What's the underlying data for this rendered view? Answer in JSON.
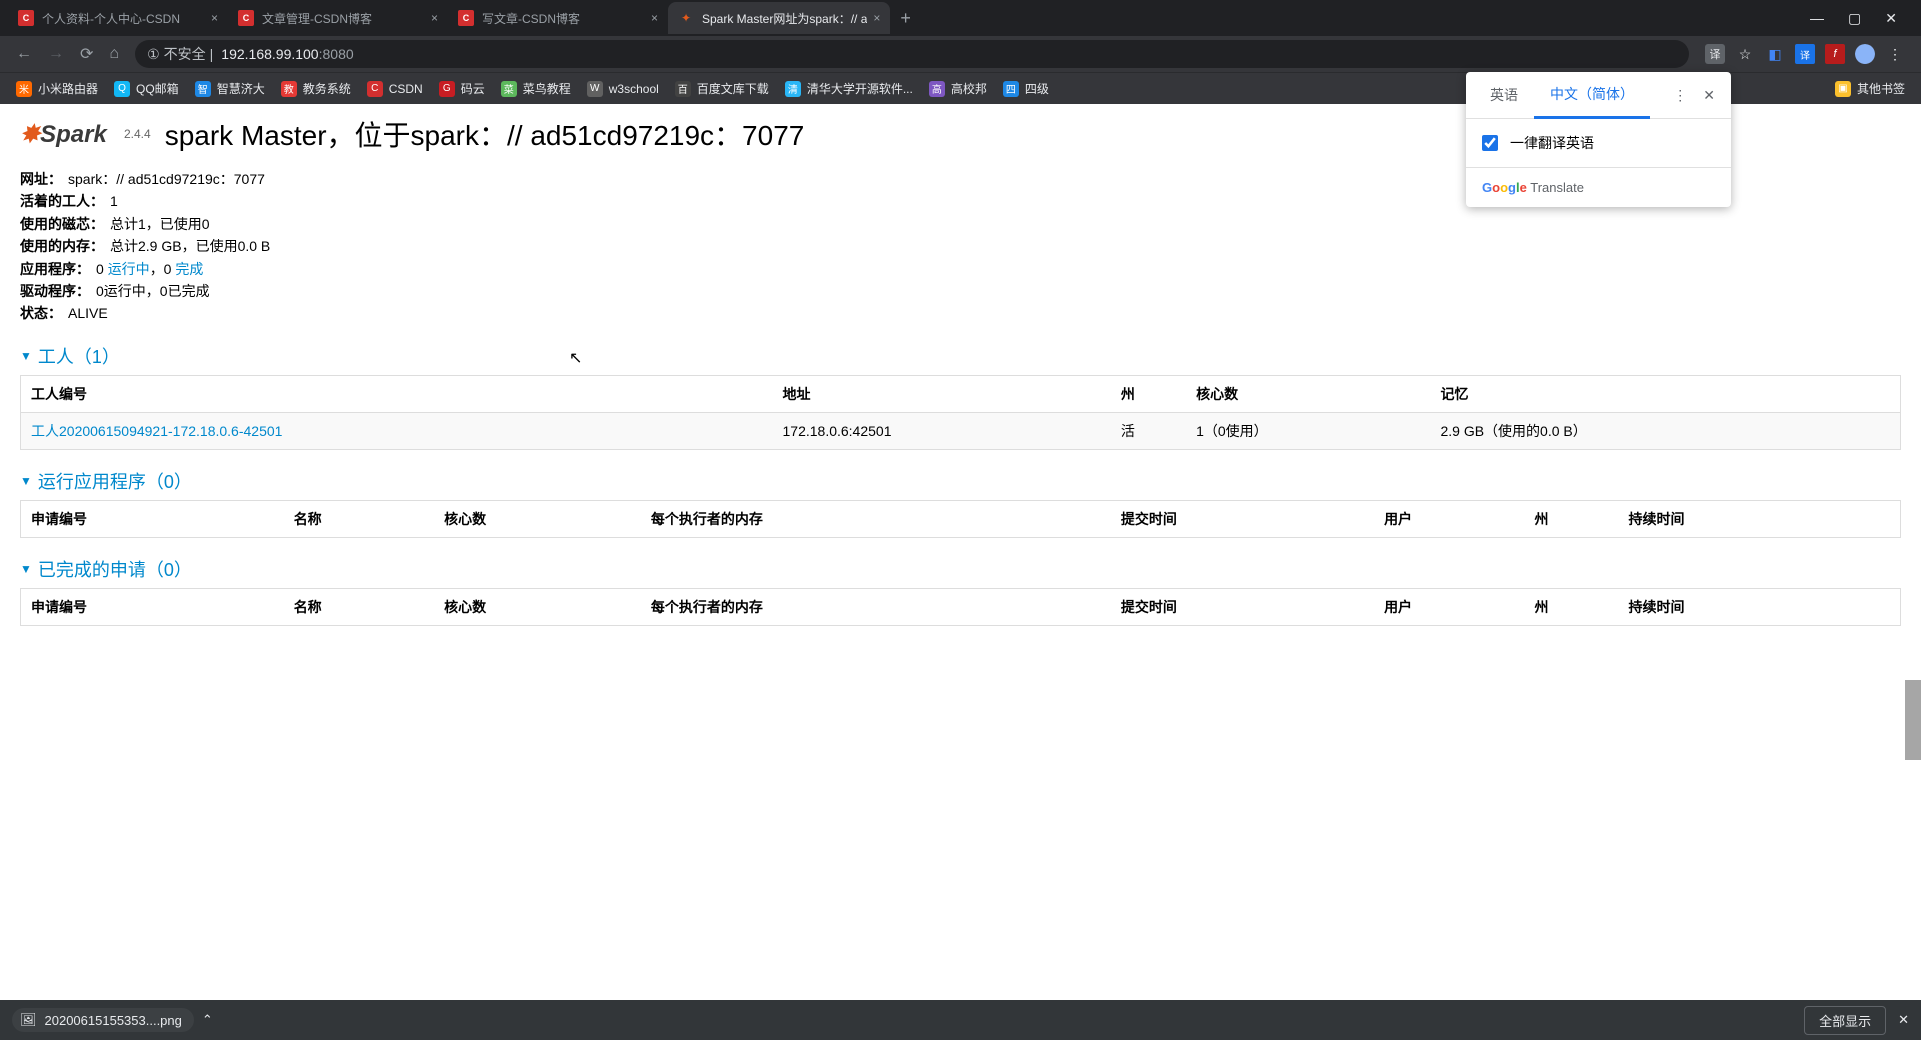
{
  "browser": {
    "tabs": [
      {
        "title": "个人资料-个人中心-CSDN"
      },
      {
        "title": "文章管理-CSDN博客"
      },
      {
        "title": "写文章-CSDN博客"
      },
      {
        "title": "Spark Master网址为spark：// a",
        "active": true
      }
    ],
    "address": {
      "insecure_label": "不安全",
      "host": "192.168.99.100",
      "port": ":8080"
    },
    "bookmarks": [
      "小米路由器",
      "QQ邮箱",
      "智慧济大",
      "教务系统",
      "CSDN",
      "码云",
      "菜鸟教程",
      "w3school",
      "百度文库下载",
      "清华大学开源软件...",
      "高校邦",
      "四级"
    ],
    "other_bookmarks": "其他书签"
  },
  "translate": {
    "tab_en": "英语",
    "tab_zh": "中文（简体）",
    "always_label": "一律翻译英语",
    "footer_brand": "Google",
    "footer_word": "Translate"
  },
  "spark": {
    "version": "2.4.4",
    "page_title": "spark Master，位于spark：// ad51cd97219c：7077",
    "info": {
      "url_label": "网址：",
      "url_value": "spark：// ad51cd97219c：7077",
      "workers_label": "活着的工人：",
      "workers_value": "1",
      "cores_label": "使用的磁芯：",
      "cores_value": "总计1，已使用0",
      "memory_label": "使用的内存：",
      "memory_value": "总计2.9 GB，已使用0.0 B",
      "apps_label": "应用程序：",
      "apps_running_count": "0",
      "apps_running_text": "运行中",
      "apps_sep": "，0",
      "apps_completed_text": "完成",
      "drivers_label": "驱动程序：",
      "drivers_value": "0运行中，0已完成",
      "state_label": "状态：",
      "state_value": "ALIVE"
    },
    "workers_section": "工人（1）",
    "workers_cols": [
      "工人编号",
      "地址",
      "州",
      "核心数",
      "记忆"
    ],
    "workers_rows": [
      {
        "id": "工人20200615094921-172.18.0.6-42501",
        "addr": "172.18.0.6:42501",
        "state": "活",
        "cores": "1（0使用）",
        "mem": "2.9 GB（使用的0.0 B）"
      }
    ],
    "running_section": "运行应用程序（0）",
    "completed_section": "已完成的申请（0）",
    "app_cols": [
      "申请编号",
      "名称",
      "核心数",
      "每个执行者的内存",
      "提交时间",
      "用户",
      "州",
      "持续时间"
    ]
  },
  "download": {
    "file": "20200615155353....png",
    "showall": "全部显示"
  }
}
